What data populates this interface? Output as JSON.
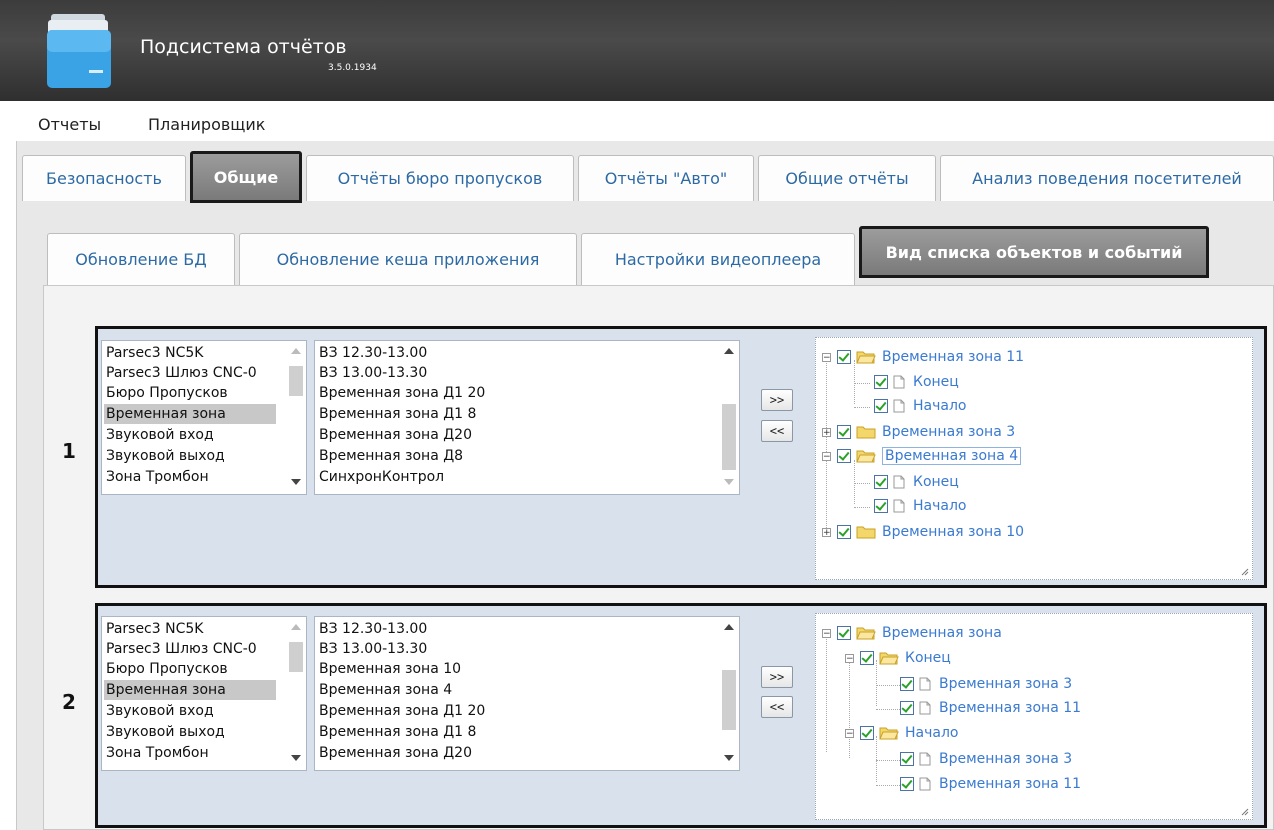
{
  "app": {
    "title": "Подсистема отчётов",
    "version": "3.5.0.1934"
  },
  "menu": [
    "Отчеты",
    "Планировщик"
  ],
  "tabs": [
    "Безопасность",
    "Общие",
    "Отчёты бюро пропусков",
    "Отчёты \"Авто\"",
    "Общие отчёты",
    "Анализ поведения посетителей"
  ],
  "active_tab": "Общие",
  "subtabs": [
    "Обновление БД",
    "Обновление кеша приложения",
    "Настройки видеоплеера",
    "Вид списка объектов и событий"
  ],
  "active_subtab": "Вид списка объектов и событий",
  "panels": [
    {
      "number": "1",
      "types": [
        "Parsec3 NC5K",
        "Parsec3 Шлюз CNC-0",
        "Бюро Пропусков",
        "Временная зона",
        "Звуковой вход",
        "Звуковой выход",
        "Зона Тромбон"
      ],
      "selected_type": "Временная зона",
      "objects": [
        "ВЗ 12.30-13.00",
        "ВЗ 13.00-13.30",
        "Временная зона Д1 20",
        "Временная зона Д1 8",
        "Временная зона Д20",
        "Временная зона Д8",
        "СинхронКонтрол"
      ],
      "add_button": ">>",
      "remove_button": "<<",
      "tree": [
        {
          "label": "Временная зона 11",
          "level": 0,
          "type": "folder",
          "expander": "−"
        },
        {
          "label": "Конец",
          "level": 1,
          "type": "file"
        },
        {
          "label": "Начало",
          "level": 1,
          "type": "file"
        },
        {
          "label": "Временная зона 3",
          "level": 0,
          "type": "folder",
          "expander": "+"
        },
        {
          "label": "Временная зона 4",
          "level": 0,
          "type": "folder",
          "expander": "−",
          "focused": true
        },
        {
          "label": "Конец",
          "level": 1,
          "type": "file"
        },
        {
          "label": "Начало",
          "level": 1,
          "type": "file"
        },
        {
          "label": "Временная зона 10",
          "level": 0,
          "type": "folder",
          "expander": "+"
        }
      ]
    },
    {
      "number": "2",
      "types": [
        "Parsec3 NC5K",
        "Parsec3 Шлюз CNC-0",
        "Бюро Пропусков",
        "Временная зона",
        "Звуковой вход",
        "Звуковой выход",
        "Зона Тромбон"
      ],
      "selected_type": "Временная зона",
      "objects": [
        "ВЗ 12.30-13.00",
        "ВЗ 13.00-13.30",
        "Временная зона 10",
        "Временная зона 4",
        "Временная зона Д1 20",
        "Временная зона Д1 8",
        "Временная зона Д20"
      ],
      "add_button": ">>",
      "remove_button": "<<",
      "tree": [
        {
          "label": "Временная зона",
          "level": 0,
          "type": "folder",
          "expander": "−"
        },
        {
          "label": "Конец",
          "level": 1,
          "type": "folder",
          "expander": "−"
        },
        {
          "label": "Временная зона 3",
          "level": 2,
          "type": "file"
        },
        {
          "label": "Временная зона 11",
          "level": 2,
          "type": "file"
        },
        {
          "label": "Начало",
          "level": 1,
          "type": "folder",
          "expander": "−"
        },
        {
          "label": "Временная зона 3",
          "level": 2,
          "type": "file"
        },
        {
          "label": "Временная зона 11",
          "level": 2,
          "type": "file"
        }
      ]
    }
  ]
}
